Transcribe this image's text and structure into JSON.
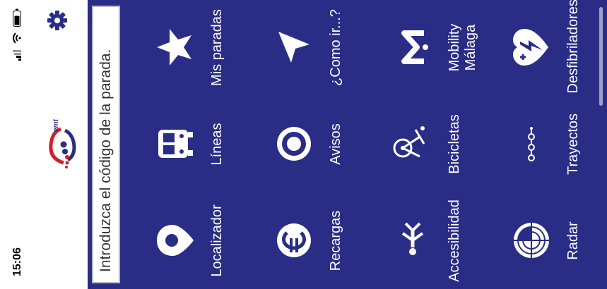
{
  "status": {
    "time": "15:06"
  },
  "search": {
    "placeholder": "Introduzca el código de la parada."
  },
  "colors": {
    "background": "#2a2d86",
    "icon": "#ffffff",
    "brand_red": "#d0202a",
    "brand_blue": "#2a2d86"
  },
  "menu": [
    {
      "label": "Localizador",
      "icon": "location-pin-icon"
    },
    {
      "label": "Líneas",
      "icon": "bus-icon"
    },
    {
      "label": "Mis paradas",
      "icon": "star-icon"
    },
    {
      "label": "Recargas",
      "icon": "euro-icon"
    },
    {
      "label": "Avisos",
      "icon": "alert-target-icon"
    },
    {
      "label": "¿Como ir...?",
      "icon": "navigation-arrow-icon"
    },
    {
      "label": "Accesibilidad",
      "icon": "accessibility-icon"
    },
    {
      "label": "Bicicletas",
      "icon": "bicycle-icon"
    },
    {
      "label": "Mobility Málaga",
      "icon": "mobility-icon"
    },
    {
      "label": "Radar",
      "icon": "radar-icon"
    },
    {
      "label": "Trayectos",
      "icon": "route-icon"
    },
    {
      "label": "Desfibriladores",
      "icon": "defibrillator-icon"
    }
  ]
}
